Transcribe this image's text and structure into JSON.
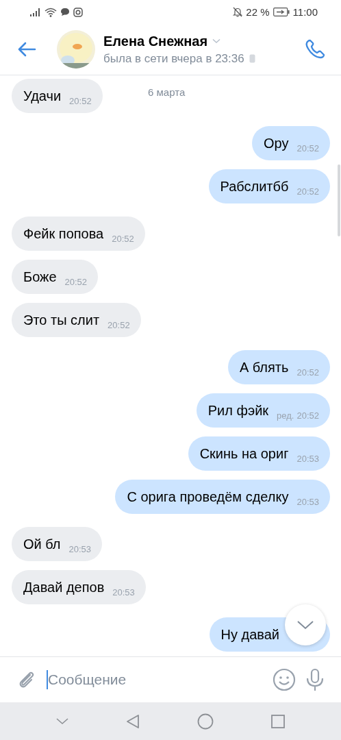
{
  "status_bar": {
    "battery": "22 %",
    "time": "11:00"
  },
  "header": {
    "name": "Елена Снежная",
    "status": "была в сети вчера в 23:36"
  },
  "date_label": "6 марта",
  "messages": [
    {
      "text": "Удачи",
      "time": "20:52",
      "outgoing": false
    },
    {
      "text": "Ору",
      "time": "20:52",
      "outgoing": true
    },
    {
      "text": "Рабслитбб",
      "time": "20:52",
      "outgoing": true
    },
    {
      "text": "Фейк попова",
      "time": "20:52",
      "outgoing": false
    },
    {
      "text": "Боже",
      "time": "20:52",
      "outgoing": false
    },
    {
      "text": "Это ты слит",
      "time": "20:52",
      "outgoing": false
    },
    {
      "text": "А блять",
      "time": "20:52",
      "outgoing": true
    },
    {
      "text": "Рил фэйк",
      "edited": "ред.",
      "time": "20:52",
      "outgoing": true
    },
    {
      "text": "Скинь на ориг",
      "time": "20:53",
      "outgoing": true
    },
    {
      "text": "С орига проведём сделку",
      "time": "20:53",
      "outgoing": true
    },
    {
      "text": "Ой бл",
      "time": "20:53",
      "outgoing": false
    },
    {
      "text": "Давай депов",
      "time": "20:53",
      "outgoing": false
    },
    {
      "text": "Ну давай",
      "outgoing": true
    }
  ],
  "composer": {
    "placeholder": "Сообщение"
  }
}
